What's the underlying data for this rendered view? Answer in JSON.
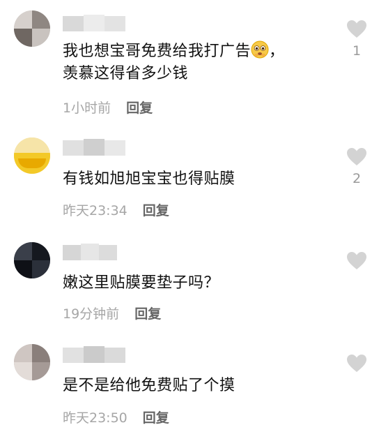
{
  "comments": [
    {
      "text_lines": [
        "我也想宝哥免费给我打广告",
        "，",
        "羡慕这得省多少钱"
      ],
      "emoji": "pleading-face-icon",
      "time": "1小时前",
      "reply": "回复",
      "likes": "1"
    },
    {
      "text_lines": [
        "有钱如旭旭宝宝也得贴膜"
      ],
      "time": "昨天23:34",
      "reply": "回复",
      "likes": "2"
    },
    {
      "text_lines": [
        "嫩这里贴膜要垫子吗？"
      ],
      "time": "19分钟前",
      "reply": "回复",
      "likes": ""
    },
    {
      "text_lines": [
        "是不是给他免费贴了个摸"
      ],
      "time": "昨天23:50",
      "reply": "回复",
      "likes": ""
    }
  ],
  "colors": {
    "text": "#111111",
    "time": "#a6a6a6",
    "reply": "#666666",
    "heart": "#d3d3d3",
    "blur": "#c8c8c8"
  }
}
